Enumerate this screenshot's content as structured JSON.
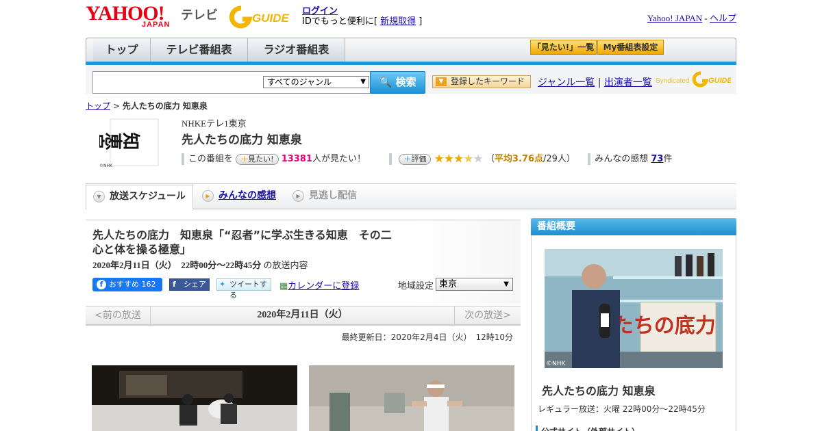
{
  "header": {
    "logo_text": "YAHOO!",
    "logo_sub": "JAPAN",
    "tv_label": "テレビ",
    "gguide_text": "G GUIDE",
    "login": "ログイン",
    "login_sub_prefix": "IDでもっと便利に[ ",
    "signup": "新規取得",
    "login_sub_suffix": " ]",
    "yahoo_japan_link": "Yahoo! JAPAN",
    "dash": " - ",
    "help_link": "ヘルプ"
  },
  "nav": {
    "tabs": [
      "トップ",
      "テレビ番組表",
      "ラジオ番組表"
    ],
    "mitai_list": "「見たい!」一覧",
    "my_schedule": "My番組表設定"
  },
  "search": {
    "genre_selected": "すべてのジャンル",
    "button": "検索",
    "keyword_btn": "登録したキーワード",
    "genre_list": "ジャンル一覧",
    "divider": " | ",
    "performer_list": "出演者一覧",
    "syndicated": "Syndicated"
  },
  "breadcrumb": {
    "top": "トップ",
    "sep": " > ",
    "current": "先人たちの底力 知恵泉"
  },
  "program": {
    "logo_caption": "知恵泉",
    "nhk_mark": "©NHK",
    "station": "NHKEテレ1東京",
    "title": "先人たちの底力 知恵泉",
    "want_prefix": "この番組を",
    "want_button": "見たい!",
    "want_count": "13381",
    "want_suffix": "人が見たい！",
    "rating_button": "評価",
    "stars": "★★★★★",
    "rating_open": "（",
    "rating_text": "平均3.76点",
    "rating_count": "/29人）",
    "impressions_label": "みんなの感想 ",
    "impressions_count": "73",
    "impressions_suffix": "件"
  },
  "tabs": {
    "schedule": "放送スケジュール",
    "impressions": "みんなの感想",
    "missed": "見逃し配信"
  },
  "episode": {
    "title": "先人たちの底力　知恵泉「“忍者”に学ぶ生きる知恵　その二　心と体を操る極意」",
    "datetime": "2020年2月11日（火）　22時00分～22時45分",
    "datetime_suffix": "の放送内容",
    "fb_recommend": "おすすめ 162",
    "share": "シェア",
    "tweet": "ツイートする",
    "calendar": "カレンダーに登録",
    "region_label": "地域設定",
    "region_value": "東京"
  },
  "daynav": {
    "prev": "<前の放送",
    "current": "2020年2月11日（火）",
    "next": "次の放送>"
  },
  "updated": "最終更新日：2020年2月4日（火）　12時10分",
  "sidebar": {
    "heading": "番組概要",
    "nhk_mark": "©NHK",
    "title": "先人たちの底力 知恵泉",
    "regular": "レギュラー放送：火曜 22時00分～22時45分",
    "official_site": "公式サイト（外部サイト）"
  },
  "colors": {
    "brand_red": "#e60012",
    "accent_blue": "#1998d5",
    "pink": "#e4007f",
    "gold": "#c08000"
  }
}
